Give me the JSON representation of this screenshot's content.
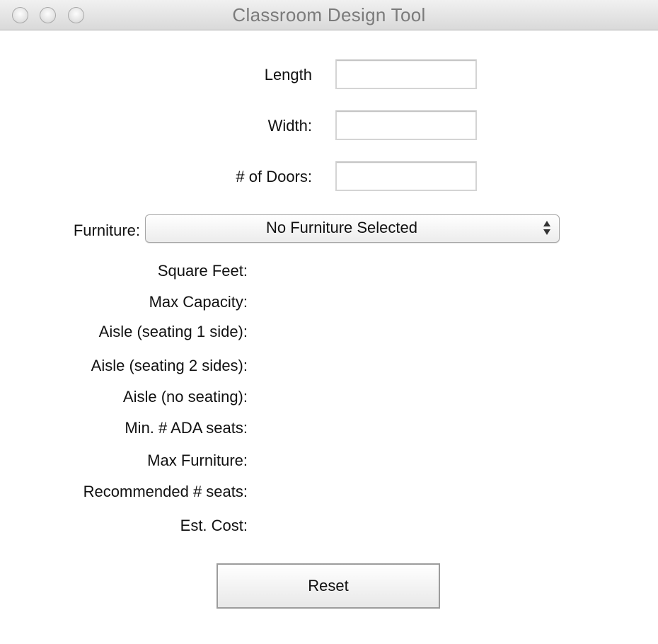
{
  "window": {
    "title": "Classroom Design Tool"
  },
  "inputs": {
    "length_label": "Length",
    "length_value": "",
    "width_label": "Width:",
    "width_value": "",
    "doors_label": "# of Doors:",
    "doors_value": ""
  },
  "furniture": {
    "label": "Furniture:",
    "selected": "No Furniture Selected"
  },
  "results": {
    "square_feet": "Square Feet:",
    "max_capacity": "Max Capacity:",
    "aisle_one_side": "Aisle (seating 1 side):",
    "aisle_two_sides": "Aisle (seating 2 sides):",
    "aisle_no_seating": "Aisle (no seating):",
    "min_ada_seats": "Min. # ADA seats:",
    "max_furniture": "Max Furniture:",
    "recommended_seats": "Recommended # seats:",
    "est_cost": "Est. Cost:"
  },
  "actions": {
    "reset_label": "Reset"
  }
}
